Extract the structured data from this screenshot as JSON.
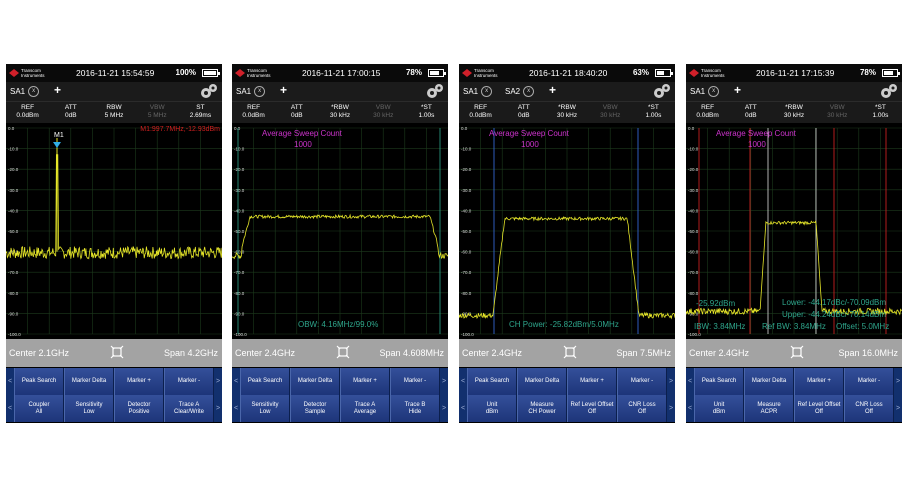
{
  "colors": {
    "trace": "#e6e629",
    "magenta": "#cc33cc",
    "teal": "#2ea58b",
    "marker": "#30aee6",
    "red_marker": "#d12020",
    "blue_line": "#3465d0",
    "red_line": "#c62020",
    "grid": "#1f3a1f",
    "softkey": "#22397d"
  },
  "panels": [
    {
      "brand": "Transcom Instruments",
      "time": "2016-11-21 15:54:59",
      "battery": "100%",
      "tabs": [
        "SA1"
      ],
      "params": [
        {
          "l": "REF",
          "v": "0.0dBm"
        },
        {
          "l": "ATT",
          "v": "0dB"
        },
        {
          "l": "RBW",
          "v": "5 MHz"
        },
        {
          "l": "VBW",
          "v": "5 MHz"
        },
        {
          "l": "ST",
          "v": "2.69ms"
        }
      ],
      "y_ticks": [
        "0.0",
        "-10.0",
        "-20.0",
        "-30.0",
        "-40.0",
        "-50.0",
        "-60.0",
        "-70.0",
        "-80.0",
        "-90.0",
        "-100.0"
      ],
      "marker_label": "M1",
      "marker_readout": "M1:997.7MHz,-12.93dBm",
      "center": "Center 2.1GHz",
      "span": "Span 4.2GHz",
      "row1": [
        "Peak Search",
        "Marker Delta",
        "Marker +",
        "Marker -"
      ],
      "row2": [
        [
          "Coupler",
          "All"
        ],
        [
          "Sensitivity",
          "Low"
        ],
        [
          "Detector",
          "Positive"
        ],
        [
          "Trace A",
          "Clear/Write"
        ]
      ]
    },
    {
      "brand": "Transcom Instruments",
      "time": "2016-11-21 17:00:15",
      "battery": "78%",
      "tabs": [
        "SA1"
      ],
      "params": [
        {
          "l": "REF",
          "v": "0.0dBm"
        },
        {
          "l": "ATT",
          "v": "0dB"
        },
        {
          "l": "*RBW",
          "v": "30 kHz"
        },
        {
          "l": "VBW",
          "v": "30 kHz"
        },
        {
          "l": "*ST",
          "v": "1.00s"
        }
      ],
      "y_ticks": [
        "0.0",
        "-10.0",
        "-20.0",
        "-30.0",
        "-40.0",
        "-50.0",
        "-60.0",
        "-70.0",
        "-80.0",
        "-90.0",
        "-100.0"
      ],
      "avg_title": "Average Sweep Count",
      "avg_count": "1000",
      "readout": "OBW: 4.16MHz/99.0%",
      "center": "Center 2.4GHz",
      "span": "Span 4.608MHz",
      "row1": [
        "Peak Search",
        "Marker Delta",
        "Marker +",
        "Marker -"
      ],
      "row2": [
        [
          "Sensitivity",
          "Low"
        ],
        [
          "Detector",
          "Sample"
        ],
        [
          "Trace A",
          "Average"
        ],
        [
          "Trace B",
          "Hide"
        ]
      ]
    },
    {
      "brand": "Transcom Instruments",
      "time": "2016-11-21 18:40:20",
      "battery": "63%",
      "tabs": [
        "SA1",
        "SA2"
      ],
      "params": [
        {
          "l": "REF",
          "v": "0.0dBm"
        },
        {
          "l": "ATT",
          "v": "0dB"
        },
        {
          "l": "*RBW",
          "v": "30 kHz"
        },
        {
          "l": "VBW",
          "v": "30 kHz"
        },
        {
          "l": "*ST",
          "v": "1.00s"
        }
      ],
      "y_ticks": [
        "0.0",
        "-10.0",
        "-20.0",
        "-30.0",
        "-40.0",
        "-50.0",
        "-60.0",
        "-70.0",
        "-80.0",
        "-90.0",
        "-100.0"
      ],
      "avg_title": "Average Sweep Count",
      "avg_count": "1000",
      "readout": "CH Power: -25.82dBm/5.0MHz",
      "center": "Center 2.4GHz",
      "span": "Span 7.5MHz",
      "row1": [
        "Peak Search",
        "Marker Delta",
        "Marker +",
        "Marker -"
      ],
      "row2": [
        [
          "Unit",
          "dBm"
        ],
        [
          "Measure",
          "CH Power"
        ],
        [
          "Ref Level Offset",
          "Off"
        ],
        [
          "CNR Loss",
          "Off"
        ]
      ]
    },
    {
      "brand": "Transcom Instruments",
      "time": "2016-11-21 17:15:39",
      "battery": "78%",
      "tabs": [
        "SA1"
      ],
      "params": [
        {
          "l": "REF",
          "v": "0.0dBm"
        },
        {
          "l": "ATT",
          "v": "0dB"
        },
        {
          "l": "*RBW",
          "v": "30 kHz"
        },
        {
          "l": "VBW",
          "v": "30 kHz"
        },
        {
          "l": "*ST",
          "v": "1.00s"
        }
      ],
      "y_ticks": [
        "0.0",
        "-10.0",
        "-20.0",
        "-30.0",
        "-40.0",
        "-50.0",
        "-60.0",
        "-70.0",
        "-80.0",
        "-90.0",
        "-100.0"
      ],
      "avg_title": "Average Sweep Count",
      "avg_count": "1000",
      "readout_power": "-25.92dBm",
      "readout_lower": "Lower: -44.17dBc/-70.09dBm",
      "readout_upper": "Upper: -44.24dBc/-70.14dBm",
      "readout_ibw": "IBW: 3.84MHz",
      "readout_refbw": "Ref BW: 3.84MHz",
      "readout_offset": "Offset: 5.0MHz",
      "center": "Center 2.4GHz",
      "span": "Span 16.0MHz",
      "row1": [
        "Peak Search",
        "Marker Delta",
        "Marker +",
        "Marker -"
      ],
      "row2": [
        [
          "Unit",
          "dBm"
        ],
        [
          "Measure",
          "ACPR"
        ],
        [
          "Ref Level Offset",
          "Off"
        ],
        [
          "CNR Loss",
          "Off"
        ]
      ]
    }
  ]
}
